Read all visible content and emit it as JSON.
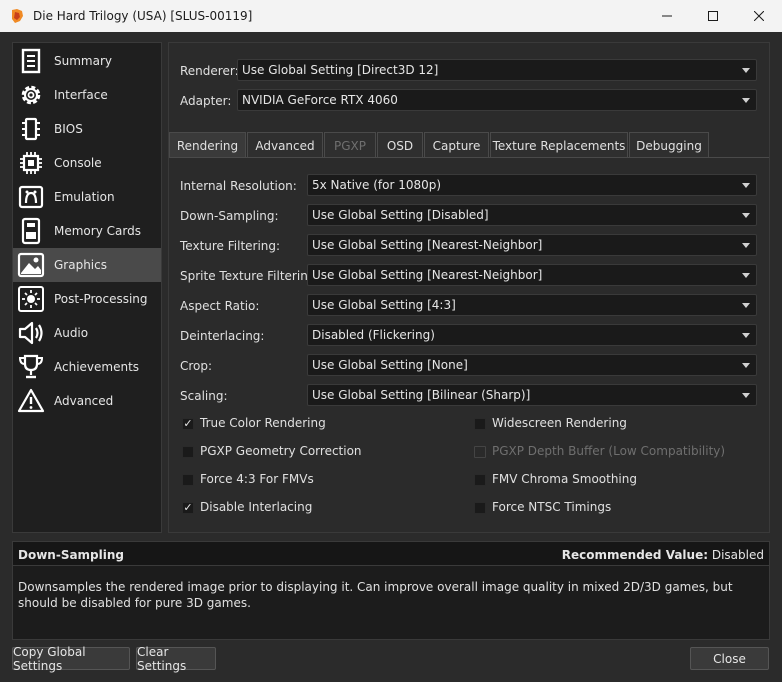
{
  "window": {
    "title": "Die Hard Trilogy (USA) [SLUS-00119]"
  },
  "sidebar": {
    "items": [
      {
        "label": "Summary",
        "icon": "summary-icon"
      },
      {
        "label": "Interface",
        "icon": "interface-gear-icon"
      },
      {
        "label": "BIOS",
        "icon": "bios-chip-icon"
      },
      {
        "label": "Console",
        "icon": "console-cpu-icon"
      },
      {
        "label": "Emulation",
        "icon": "emulation-icon"
      },
      {
        "label": "Memory Cards",
        "icon": "memory-card-icon"
      },
      {
        "label": "Graphics",
        "icon": "graphics-image-icon"
      },
      {
        "label": "Post-Processing",
        "icon": "post-processing-sun-icon"
      },
      {
        "label": "Audio",
        "icon": "audio-speaker-icon"
      },
      {
        "label": "Achievements",
        "icon": "achievements-trophy-icon"
      },
      {
        "label": "Advanced",
        "icon": "advanced-warning-icon"
      }
    ],
    "active_index": 6
  },
  "renderer": {
    "label": "Renderer:",
    "value": "Use Global Setting [Direct3D 12]"
  },
  "adapter": {
    "label": "Adapter:",
    "value": "NVIDIA GeForce RTX 4060"
  },
  "tabs": [
    {
      "label": "Rendering",
      "active": true,
      "disabled": false
    },
    {
      "label": "Advanced",
      "active": false,
      "disabled": false
    },
    {
      "label": "PGXP",
      "active": false,
      "disabled": true
    },
    {
      "label": "OSD",
      "active": false,
      "disabled": false
    },
    {
      "label": "Capture",
      "active": false,
      "disabled": false
    },
    {
      "label": "Texture Replacements",
      "active": false,
      "disabled": false
    },
    {
      "label": "Debugging",
      "active": false,
      "disabled": false
    }
  ],
  "rendering": {
    "settings": [
      {
        "label": "Internal Resolution:",
        "value": "5x Native (for 1080p)"
      },
      {
        "label": "Down-Sampling:",
        "value": "Use Global Setting [Disabled]"
      },
      {
        "label": "Texture Filtering:",
        "value": "Use Global Setting [Nearest-Neighbor]"
      },
      {
        "label": "Sprite Texture Filtering:",
        "value": "Use Global Setting [Nearest-Neighbor]"
      },
      {
        "label": "Aspect Ratio:",
        "value": "Use Global Setting [4:3]"
      },
      {
        "label": "Deinterlacing:",
        "value": "Disabled (Flickering)"
      },
      {
        "label": "Crop:",
        "value": "Use Global Setting [None]"
      },
      {
        "label": "Scaling:",
        "value": "Use Global Setting [Bilinear (Sharp)]"
      }
    ],
    "checkboxes_left": [
      {
        "label": "True Color Rendering",
        "checked": true,
        "disabled": false
      },
      {
        "label": "PGXP Geometry Correction",
        "checked": false,
        "disabled": false
      },
      {
        "label": "Force 4:3 For FMVs",
        "checked": false,
        "disabled": false
      },
      {
        "label": "Disable Interlacing",
        "checked": true,
        "disabled": false
      }
    ],
    "checkboxes_right": [
      {
        "label": "Widescreen Rendering",
        "checked": false,
        "disabled": false
      },
      {
        "label": "PGXP Depth Buffer (Low Compatibility)",
        "checked": false,
        "disabled": true
      },
      {
        "label": "FMV Chroma Smoothing",
        "checked": false,
        "disabled": false
      },
      {
        "label": "Force NTSC Timings",
        "checked": false,
        "disabled": false
      }
    ]
  },
  "description": {
    "title": "Down-Sampling",
    "recommended_label": "Recommended Value:",
    "recommended_value": "Disabled",
    "text": "Downsamples the rendered image prior to displaying it. Can improve overall image quality in mixed 2D/3D games, but should be disabled for pure 3D games."
  },
  "buttons": {
    "copy_global": "Copy Global Settings",
    "clear": "Clear Settings",
    "close": "Close"
  },
  "colors": {
    "background": "#2b2b2b",
    "sidebar_active": "#4a4a4a",
    "titlebar": "#f3f3f3"
  }
}
